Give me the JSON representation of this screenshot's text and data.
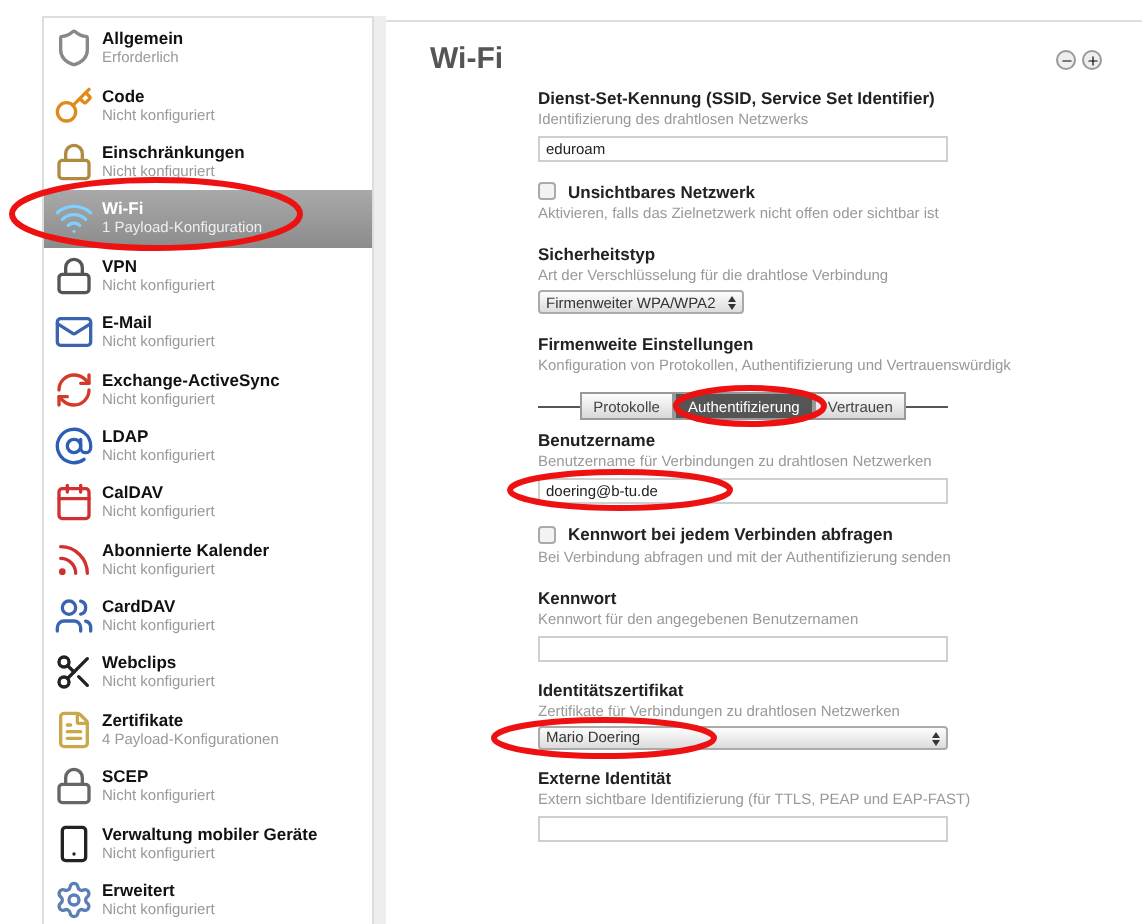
{
  "sidebar": {
    "items": [
      {
        "title": "Allgemein",
        "subtitle": "Erforderlich",
        "selected": false
      },
      {
        "title": "Code",
        "subtitle": "Nicht konfiguriert",
        "selected": false
      },
      {
        "title": "Einschränkungen",
        "subtitle": "Nicht konfiguriert",
        "selected": false
      },
      {
        "title": "Wi-Fi",
        "subtitle": "1 Payload-Konfiguration",
        "selected": true
      },
      {
        "title": "VPN",
        "subtitle": "Nicht konfiguriert",
        "selected": false
      },
      {
        "title": "E-Mail",
        "subtitle": "Nicht konfiguriert",
        "selected": false
      },
      {
        "title": "Exchange-ActiveSync",
        "subtitle": "Nicht konfiguriert",
        "selected": false
      },
      {
        "title": "LDAP",
        "subtitle": "Nicht konfiguriert",
        "selected": false
      },
      {
        "title": "CalDAV",
        "subtitle": "Nicht konfiguriert",
        "selected": false
      },
      {
        "title": "Abonnierte Kalender",
        "subtitle": "Nicht konfiguriert",
        "selected": false
      },
      {
        "title": "CardDAV",
        "subtitle": "Nicht konfiguriert",
        "selected": false
      },
      {
        "title": "Webclips",
        "subtitle": "Nicht konfiguriert",
        "selected": false
      },
      {
        "title": "Zertifikate",
        "subtitle": "4 Payload-Konfigurationen",
        "selected": false
      },
      {
        "title": "SCEP",
        "subtitle": "Nicht konfiguriert",
        "selected": false
      },
      {
        "title": "Verwaltung mobiler Geräte",
        "subtitle": "Nicht konfiguriert",
        "selected": false
      },
      {
        "title": "Erweitert",
        "subtitle": "Nicht konfiguriert",
        "selected": false
      }
    ]
  },
  "panel": {
    "title": "Wi-Fi",
    "form": [
      {
        "kind": "field",
        "label": "Dienst-Set-Kennung (SSID, Service Set Identifier)",
        "hint": "Identifizierung des drahtlosen Netzwerks",
        "value": "eduroam"
      },
      {
        "kind": "checkbox",
        "label": "Unsichtbares Netzwerk",
        "hint": "Aktivieren, falls das Zielnetzwerk nicht offen oder sichtbar ist",
        "checked": false
      },
      {
        "kind": "select",
        "label": "Sicherheitstyp",
        "hint": "Art der Verschlüsselung für die drahtlose Verbindung",
        "value": "Firmenweiter WPA/WPA2",
        "full_width": false
      },
      {
        "kind": "section",
        "label": "Firmenweite Einstellungen",
        "hint": "Konfiguration von Protokollen, Authentifizierung und Vertrauenswürdigk"
      },
      {
        "kind": "tabs",
        "tabs": [
          {
            "label": "Protokolle",
            "selected": false
          },
          {
            "label": "Authentifizierung",
            "selected": true
          },
          {
            "label": "Vertrauen",
            "selected": false
          }
        ]
      },
      {
        "kind": "field",
        "label": "Benutzername",
        "hint": "Benutzername für Verbindungen zu drahtlosen Netzwerken",
        "value": "doering@b-tu.de"
      },
      {
        "kind": "checkbox",
        "label": "Kennwort bei jedem Verbinden abfragen",
        "hint": "Bei Verbindung abfragen und mit der Authentifizierung senden",
        "checked": false
      },
      {
        "kind": "field",
        "label": "Kennwort",
        "hint": "Kennwort für den angegebenen Benutzernamen"
      },
      {
        "kind": "select",
        "label": "Identitätszertifikat",
        "hint": "Zertifikate für Verbindungen zu drahtlosen Netzwerken",
        "value": "Mario Doering",
        "full_width": true
      },
      {
        "kind": "field",
        "label": "Externe Identität",
        "hint": "Extern sichtbare Identifizierung (für TTLS, PEAP und EAP-FAST)"
      }
    ]
  }
}
